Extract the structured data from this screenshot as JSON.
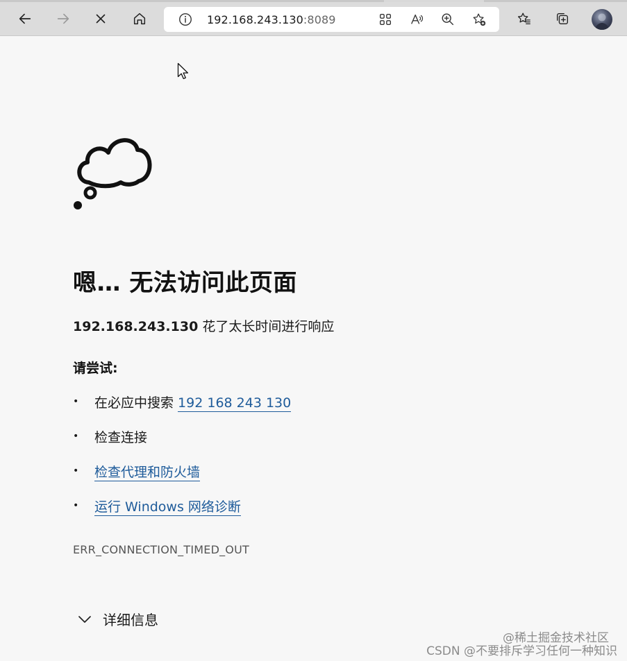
{
  "browser": {
    "url_host": "192.168.243.130",
    "url_port": ":8089"
  },
  "error_page": {
    "title": "嗯… 无法访问此页面",
    "subtitle_host": "192.168.243.130",
    "subtitle_text": " 花了太长时间进行响应",
    "try_heading": "请尝试:",
    "suggestions": [
      {
        "prefix": "在必应中搜索 ",
        "link": "192 168 243 130"
      },
      {
        "prefix": "检查连接",
        "link": ""
      },
      {
        "prefix": "",
        "link": "检查代理和防火墙"
      },
      {
        "prefix": "",
        "link": "运行 Windows 网络诊断"
      }
    ],
    "error_code": "ERR_CONNECTION_TIMED_OUT",
    "details_label": "详细信息"
  },
  "watermark": {
    "line1": "@稀土掘金技术社区",
    "line2": "CSDN @不要排斥学习任何一种知识"
  },
  "colors": {
    "link": "#1e5b9a",
    "background": "#f7f7f7",
    "toolbar": "#dcdcdc"
  }
}
